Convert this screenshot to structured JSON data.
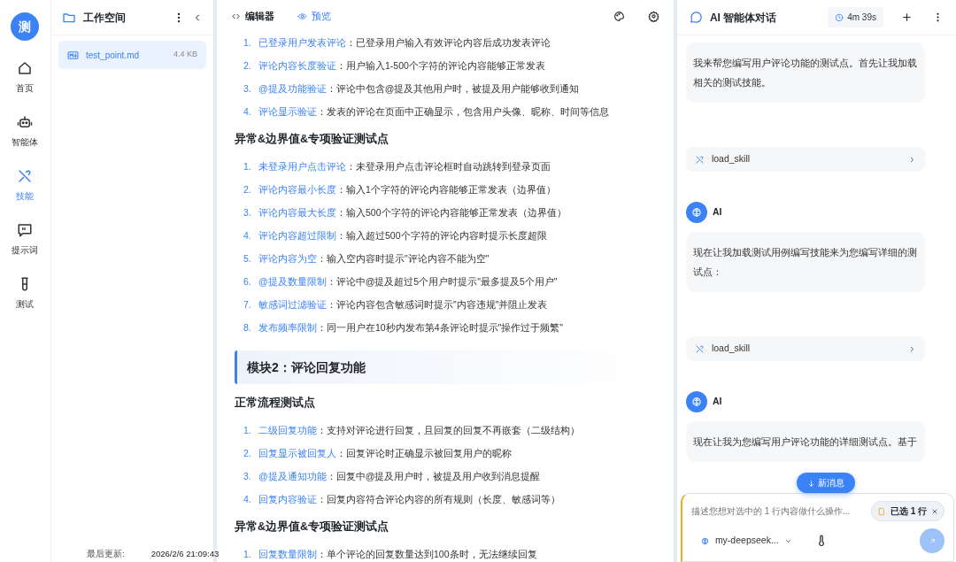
{
  "rail": {
    "logo": "测",
    "items": [
      {
        "label": "首页",
        "selected": false
      },
      {
        "label": "智能体",
        "selected": false
      },
      {
        "label": "技能",
        "selected": true
      },
      {
        "label": "提示词",
        "selected": false
      },
      {
        "label": "测试",
        "selected": false
      }
    ]
  },
  "workspace": {
    "title": "工作空间",
    "files": [
      {
        "name": "test_point.md",
        "size": "4.4 KB",
        "selected": true
      }
    ],
    "footer": {
      "label": "最后更新:",
      "time": "2026/2/6 21:09:43"
    }
  },
  "editor": {
    "tabs": [
      {
        "label": "编辑器",
        "selected": true
      },
      {
        "label": "预览",
        "selected": false
      }
    ],
    "blocks": [
      {
        "kind": "list",
        "items": [
          {
            "num": "1.",
            "term": "已登录用户发表评论",
            "text": "：已登录用户输入有效评论内容后成功发表评论"
          },
          {
            "num": "2.",
            "term": "评论内容长度验证",
            "text": "：用户输入1-500个字符的评论内容能够正常发表"
          },
          {
            "num": "3.",
            "term": "@提及功能验证",
            "text": "：评论中包含@提及其他用户时，被提及用户能够收到通知"
          },
          {
            "num": "4.",
            "term": "评论显示验证",
            "text": "：发表的评论在页面中正确显示，包含用户头像、昵称、时间等信息"
          }
        ]
      },
      {
        "kind": "heading",
        "text": "异常&边界值&专项验证测试点"
      },
      {
        "kind": "list",
        "items": [
          {
            "num": "1.",
            "term": "未登录用户点击评论",
            "text": "：未登录用户点击评论框时自动跳转到登录页面"
          },
          {
            "num": "2.",
            "term": "评论内容最小长度",
            "text": "：输入1个字符的评论内容能够正常发表（边界值）"
          },
          {
            "num": "3.",
            "term": "评论内容最大长度",
            "text": "：输入500个字符的评论内容能够正常发表（边界值）"
          },
          {
            "num": "4.",
            "term": "评论内容超过限制",
            "text": "：输入超过500个字符的评论内容时提示长度超限"
          },
          {
            "num": "5.",
            "term": "评论内容为空",
            "text": "：输入空内容时提示\"评论内容不能为空\""
          },
          {
            "num": "6.",
            "term": "@提及数量限制",
            "text": "：评论中@提及超过5个用户时提示\"最多提及5个用户\""
          },
          {
            "num": "7.",
            "term": "敏感词过滤验证",
            "text": "：评论内容包含敏感词时提示\"内容违规\"并阻止发表"
          },
          {
            "num": "8.",
            "term": "发布频率限制",
            "text": "：同一用户在10秒内发布第4条评论时提示\"操作过于频繁\""
          }
        ]
      },
      {
        "kind": "module",
        "text": "模块2：评论回复功能"
      },
      {
        "kind": "heading",
        "text": "正常流程测试点"
      },
      {
        "kind": "list",
        "items": [
          {
            "num": "1.",
            "term": "二级回复功能",
            "text": "：支持对评论进行回复，且回复的回复不再嵌套（二级结构）"
          },
          {
            "num": "2.",
            "term": "回复显示被回复人",
            "text": "：回复评论时正确显示被回复用户的昵称"
          },
          {
            "num": "3.",
            "term": "@提及通知功能",
            "text": "：回复中@提及用户时，被提及用户收到消息提醒"
          },
          {
            "num": "4.",
            "term": "回复内容验证",
            "text": "：回复内容符合评论内容的所有规则（长度、敏感词等）"
          }
        ]
      },
      {
        "kind": "heading",
        "text": "异常&边界值&专项验证测试点"
      },
      {
        "kind": "list",
        "items": [
          {
            "num": "1.",
            "term": "回复数量限制",
            "text": "：单个评论的回复数量达到100条时，无法继续回复"
          }
        ]
      }
    ]
  },
  "chat": {
    "title": "AI 智能体对话",
    "timer": "4m 39s",
    "messages": [
      {
        "kind": "bubble",
        "text": "我来帮您编写用户评论功能的测试点。首先让我加载相关的测试技能。"
      },
      {
        "kind": "tool",
        "text": "load_skill"
      },
      {
        "kind": "sender",
        "text": "AI"
      },
      {
        "kind": "bubble",
        "text": "现在让我加载测试用例编写技能来为您编写详细的测试点："
      },
      {
        "kind": "tool",
        "text": "load_skill"
      },
      {
        "kind": "sender",
        "text": "AI"
      },
      {
        "kind": "bubble",
        "text": "现在让我为您编写用户评论功能的详细测试点。基于"
      }
    ],
    "new_message": "新消息",
    "input": {
      "placeholder": "描述您想对选中的 1 行内容做什么操作...",
      "chip": "已选 1 行",
      "model": "my-deepseek..."
    }
  }
}
